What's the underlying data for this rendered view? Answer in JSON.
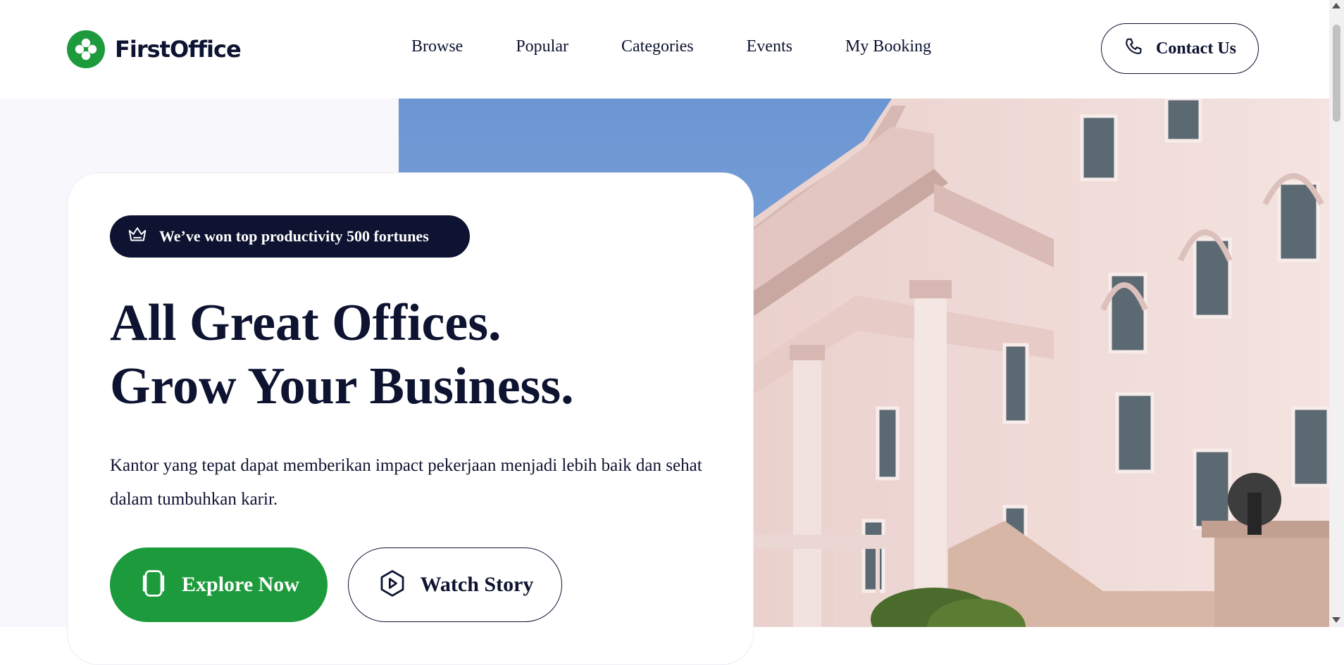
{
  "brand": {
    "name": "FirstOffice",
    "logo_icon": "clover-logo-icon",
    "accent_color": "#1d9a3c",
    "ink_color": "#0d1330"
  },
  "nav": {
    "links": [
      "Browse",
      "Popular",
      "Categories",
      "Events",
      "My Booking"
    ],
    "contact_label": "Contact Us",
    "contact_icon": "phone-icon"
  },
  "hero": {
    "badge_icon": "crown-icon",
    "badge_text": "We’ve won top productivity 500 fortunes",
    "headline_line1": "All Great Offices.",
    "headline_line2": "Grow Your Business.",
    "subtext": "Kantor yang tepat dapat memberikan impact pekerjaan menjadi lebih baik dan sehat dalam tumbuhkan karir.",
    "primary_button": {
      "label": "Explore Now",
      "icon": "tablet-icon"
    },
    "secondary_button": {
      "label": "Watch Story",
      "icon": "play-hexagon-icon"
    },
    "image": "office-building-photo"
  }
}
